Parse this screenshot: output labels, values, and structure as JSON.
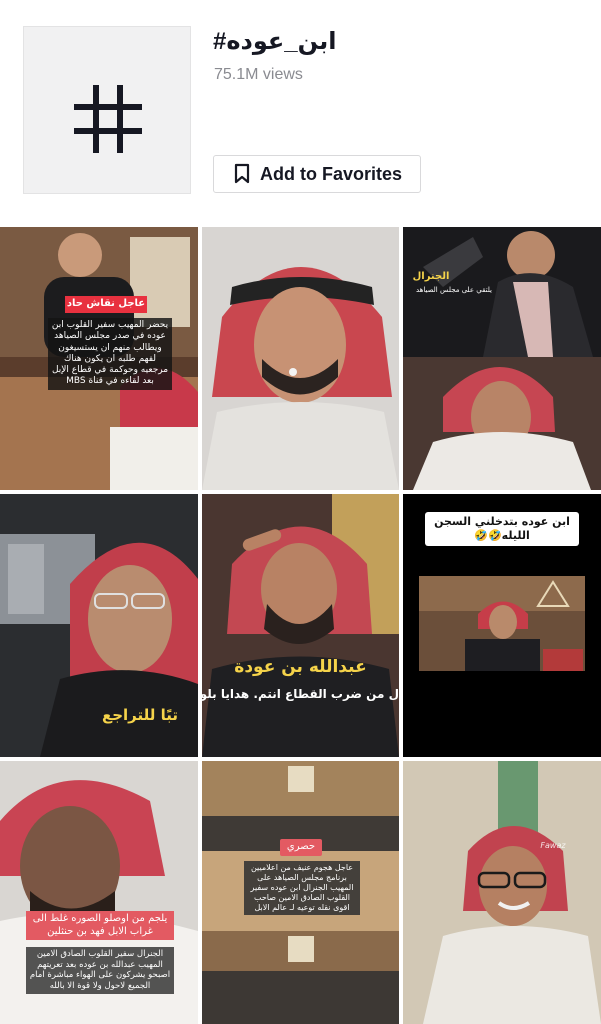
{
  "header": {
    "title": "#ابن_عوده",
    "views": "75.1M views",
    "favorite_label": "Add to Favorites",
    "cover_icon": "hashtag-icon",
    "favorite_icon": "bookmark-icon"
  },
  "videos": [
    {
      "badge": "عاجل نقاش حاد",
      "caption": "يحضر المهيب سفير القلوب ابن عوده في صدر مجلس الصياهد ويطالب منهم ان يستسيغون لفهم طلبه ان يكون هناك مرجعيه وحوكمة في قطاع الإبل بعد لقاءه في قناة MBS"
    },
    {
      "caption": ""
    },
    {
      "label": "الجنرال",
      "sublabel": "يلتقي على مجلس الصياهد"
    },
    {
      "caption": "تبًا للتراجع"
    },
    {
      "title": "عبدالله بن عودة",
      "caption": "ل من ضرب القطاع انتم. هدايا بلوش"
    },
    {
      "caption": "ابن عوده بتدخلني السجن الليله🤣🤣"
    },
    {
      "badge": "يلجم من اوصلو الصوره غلط الى غراب الابل فهد بن حنثلين",
      "caption": "الجنرال سفير القلوب الصادق الامين المهيب عبدالله بن عوده بعد تعريتهم اصبحو يشركون على الهواء مباشرة امام الجميع لاحول ولا قوة الا بالله"
    },
    {
      "badge": "حصري",
      "caption": "عاجل هجوم عنيف من اعلاميين برنامج مجلس الصياهد على المهيب الجنرال ابن عوده سفير القلوب الصادق الامين صاحب اقوى نقله توعيه لـ عالم الابل"
    },
    {
      "watermark": "Fawaz"
    }
  ],
  "colors": {
    "accent_red": "#e8313f",
    "muted": "#8a8b91",
    "text": "#161823"
  }
}
